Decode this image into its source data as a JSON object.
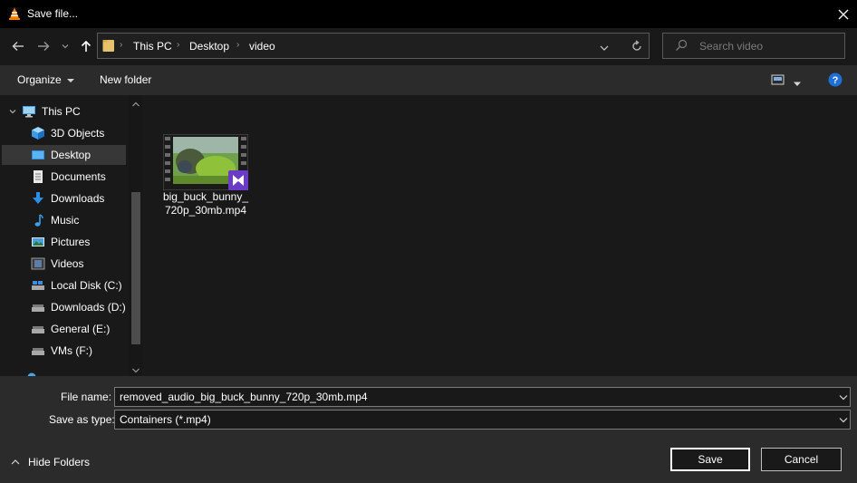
{
  "window": {
    "title": "Save file...",
    "app_icon": "vlc-cone-icon"
  },
  "nav": {
    "breadcrumb": [
      "This PC",
      "Desktop",
      "video"
    ],
    "search_placeholder": "Search video"
  },
  "toolbar": {
    "organize": "Organize",
    "new_folder": "New folder"
  },
  "sidebar": {
    "items": [
      {
        "label": "This PC",
        "icon": "computer-icon"
      },
      {
        "label": "3D Objects",
        "icon": "cube-icon"
      },
      {
        "label": "Desktop",
        "icon": "desktop-icon",
        "selected": true
      },
      {
        "label": "Documents",
        "icon": "document-icon"
      },
      {
        "label": "Downloads",
        "icon": "download-icon"
      },
      {
        "label": "Music",
        "icon": "music-icon"
      },
      {
        "label": "Pictures",
        "icon": "pictures-icon"
      },
      {
        "label": "Videos",
        "icon": "videos-icon"
      },
      {
        "label": "Local Disk (C:)",
        "icon": "drive-icon"
      },
      {
        "label": "Downloads (D:)",
        "icon": "drive-icon"
      },
      {
        "label": "General (E:)",
        "icon": "drive-icon"
      },
      {
        "label": "VMs (F:)",
        "icon": "drive-icon"
      }
    ]
  },
  "files": [
    {
      "name_line1": "big_buck_bunny_",
      "name_line2": "720p_30mb.mp4",
      "icon": "video-file-icon"
    }
  ],
  "form": {
    "file_name_label": "File name:",
    "file_name_value": "removed_audio_big_buck_bunny_720p_30mb.mp4",
    "type_label": "Save as type:",
    "type_value": "Containers (*.mp4)"
  },
  "footer": {
    "hide_folders": "Hide Folders",
    "save": "Save",
    "cancel": "Cancel"
  },
  "colors": {
    "accent": "#0078d7",
    "background": "#191919",
    "toolbar": "#2b2b2b"
  }
}
